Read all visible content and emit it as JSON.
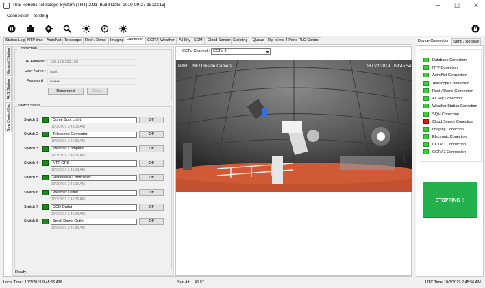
{
  "window": {
    "title": "Thai Robotic Telescope System (TRT) 2.91 [Build Date: 2019-09-27 15:20:15]",
    "minimize": "─",
    "maximize": "☐",
    "close": "✕"
  },
  "menu": [
    "Connection",
    "Setting"
  ],
  "toolbar": {
    "icons": [
      "pause-icon",
      "usb-device-icon",
      "gear-icon",
      "tools-icon",
      "sun-icon",
      "crosshair-icon",
      "network-icon"
    ],
    "right_icon": "lock-icon"
  },
  "tabs": [
    {
      "label": "Station Log",
      "active": false
    },
    {
      "label": "NTP time",
      "active": false
    },
    {
      "label": "AstroNet",
      "active": false
    },
    {
      "label": "Telescope",
      "active": false
    },
    {
      "label": "Roof / Dome",
      "active": false
    },
    {
      "label": "Imaging",
      "active": false
    },
    {
      "label": "Electronic",
      "active": true
    },
    {
      "label": "CCTV",
      "active": false
    },
    {
      "label": "Weather",
      "active": false
    },
    {
      "label": "All Sky",
      "active": false
    },
    {
      "label": "SGM",
      "active": false
    },
    {
      "label": "Cloud Sensor",
      "active": false
    },
    {
      "label": "Scripting",
      "active": false
    },
    {
      "label": "Queue",
      "active": false
    },
    {
      "label": "Rip Mirror 4 Ports",
      "active": false
    },
    {
      "label": "PLC Control",
      "active": false
    }
  ],
  "vertical_tabs": [
    "General Station",
    "AUS Station",
    "New Control Box"
  ],
  "connection": {
    "group_title": "Connection",
    "ip_label": "IP Address :",
    "ip_value": "192.168.100.198",
    "user_label": "User Name :",
    "user_value": "narit",
    "pass_label": "Password :",
    "pass_value": "••••••••",
    "disconnect": "Disconnect",
    "clear": "Clear"
  },
  "switch_status": {
    "group_title": "Switch Status",
    "switches": [
      {
        "label": "Switch 1 :",
        "name": "Dome Spot Light",
        "time": "10/3/2019 2:45:36 AM",
        "button": "Off"
      },
      {
        "label": "Switch 2 :",
        "name": "Telescope Computer",
        "time": "10/3/2019 2:45:36 AM",
        "button": "Off"
      },
      {
        "label": "Switch 3 :",
        "name": "Weather Computer",
        "time": "10/3/2019 2:45:36 AM",
        "button": "Off"
      },
      {
        "label": "Switch 4 :",
        "name": "NTP GPS",
        "time": "10/3/2019 2:45:36 AM",
        "button": "Off"
      },
      {
        "label": "Switch 5 :",
        "name": "Planewave ControlBox",
        "time": "10/3/2019 2:45:36 AM",
        "button": "Off"
      },
      {
        "label": "Switch 6 :",
        "name": "Weather Outlet",
        "time": "10/3/2019 2:45:36 AM",
        "button": "Off"
      },
      {
        "label": "Switch 7 :",
        "name": "CCD Outlet",
        "time": "10/3/2019 2:45:36 AM",
        "button": "Off"
      },
      {
        "label": "Switch 8 :",
        "name": "Small Dome Outlet",
        "time": "10/3/2019 2:45:36 AM",
        "button": "Off"
      }
    ]
  },
  "panel_status": "Ready.",
  "cctv": {
    "channel_label": "CCTV Channel :",
    "channel_value": "CCTV 2",
    "camera_title": "NARIT NEO Inside Camera",
    "camera_date": "03 Oct 2019",
    "camera_time": "09:45:54"
  },
  "right_tabs": [
    {
      "label": "Device Connection",
      "active": true
    },
    {
      "label": "Send / Recieve",
      "active": false
    }
  ],
  "devices": [
    {
      "name": "Database Conection",
      "status": "green"
    },
    {
      "name": "NTP Conection",
      "status": "green"
    },
    {
      "name": "AstroNet Connection",
      "status": "green"
    },
    {
      "name": "Telescope Connection",
      "status": "green"
    },
    {
      "name": "Roof / Dome Connection",
      "status": "green"
    },
    {
      "name": "All Sky Conection",
      "status": "green"
    },
    {
      "name": "Weather Station  Conection",
      "status": "green"
    },
    {
      "name": "SQM Conection",
      "status": "green"
    },
    {
      "name": "Cloud Sensor Conection",
      "status": "red"
    },
    {
      "name": "Imaging Conection",
      "status": "green"
    },
    {
      "name": "Electronic Conection",
      "status": "green"
    },
    {
      "name": "CCTV 1 Connection",
      "status": "green"
    },
    {
      "name": "CCTV 2 Connection",
      "status": "green"
    }
  ],
  "stop_button": "STOPPING !!",
  "statusbar": {
    "local_label": "Local Time:",
    "local_value": "10/3/2019 9:45:56 AM",
    "sun_label": "Sun Alt:",
    "sun_value": "46.97",
    "utc_label": "UTC Time:",
    "utc_value": "10/3/2019 2:45:56 AM"
  },
  "colors": {
    "led_green": "#3ccf3c",
    "led_red": "#e01414",
    "switch_green": "#1b8a1b",
    "stop_green": "#22b14c"
  }
}
